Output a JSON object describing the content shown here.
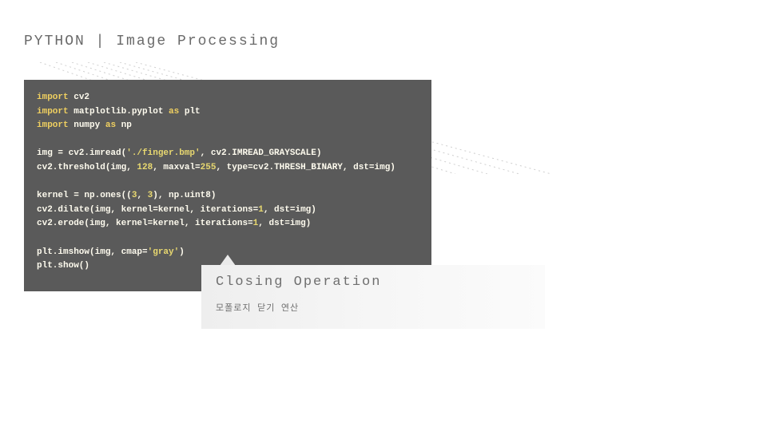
{
  "header": {
    "title": "PYTHON | Image Processing"
  },
  "code": {
    "lines": [
      [
        [
          "kw",
          "import"
        ],
        [
          "",
          ""
        ],
        [
          "",
          "cv2"
        ]
      ],
      [
        [
          "kw",
          "import"
        ],
        [
          "",
          ""
        ],
        [
          "",
          "matplotlib.pyplot"
        ],
        [
          "",
          ""
        ],
        [
          "kw",
          "as"
        ],
        [
          "",
          ""
        ],
        [
          "",
          "plt"
        ]
      ],
      [
        [
          "kw",
          "import"
        ],
        [
          "",
          ""
        ],
        [
          "",
          "numpy"
        ],
        [
          "",
          ""
        ],
        [
          "kw",
          "as"
        ],
        [
          "",
          ""
        ],
        [
          "",
          "np"
        ]
      ],
      [
        [
          "",
          ""
        ]
      ],
      [
        [
          "",
          "img = cv2.imread("
        ],
        [
          "str",
          "'./finger.bmp'"
        ],
        [
          "",
          ", cv2.IMREAD_GRAYSCALE)"
        ]
      ],
      [
        [
          "",
          "cv2.threshold(img, "
        ],
        [
          "num",
          "128"
        ],
        [
          "",
          ", maxval="
        ],
        [
          "num",
          "255"
        ],
        [
          "",
          ", type=cv2.THRESH_BINARY, dst=img)"
        ]
      ],
      [
        [
          "",
          ""
        ]
      ],
      [
        [
          "",
          "kernel = np.ones(("
        ],
        [
          "num",
          "3"
        ],
        [
          "",
          ", "
        ],
        [
          "num",
          "3"
        ],
        [
          "",
          "), np.uint8)"
        ]
      ],
      [
        [
          "",
          "cv2.dilate(img, kernel=kernel, iterations="
        ],
        [
          "num",
          "1"
        ],
        [
          "",
          ", dst=img)"
        ]
      ],
      [
        [
          "",
          "cv2.erode(img, kernel=kernel, iterations="
        ],
        [
          "num",
          "1"
        ],
        [
          "",
          ", dst=img)"
        ]
      ],
      [
        [
          "",
          ""
        ]
      ],
      [
        [
          "",
          "plt.imshow(img, cmap="
        ],
        [
          "str",
          "'gray'"
        ],
        [
          "",
          ")"
        ]
      ],
      [
        [
          "",
          "plt.show()"
        ]
      ]
    ]
  },
  "callout": {
    "title": "Closing Operation",
    "subtitle": "모폴로지 닫기 연산"
  }
}
